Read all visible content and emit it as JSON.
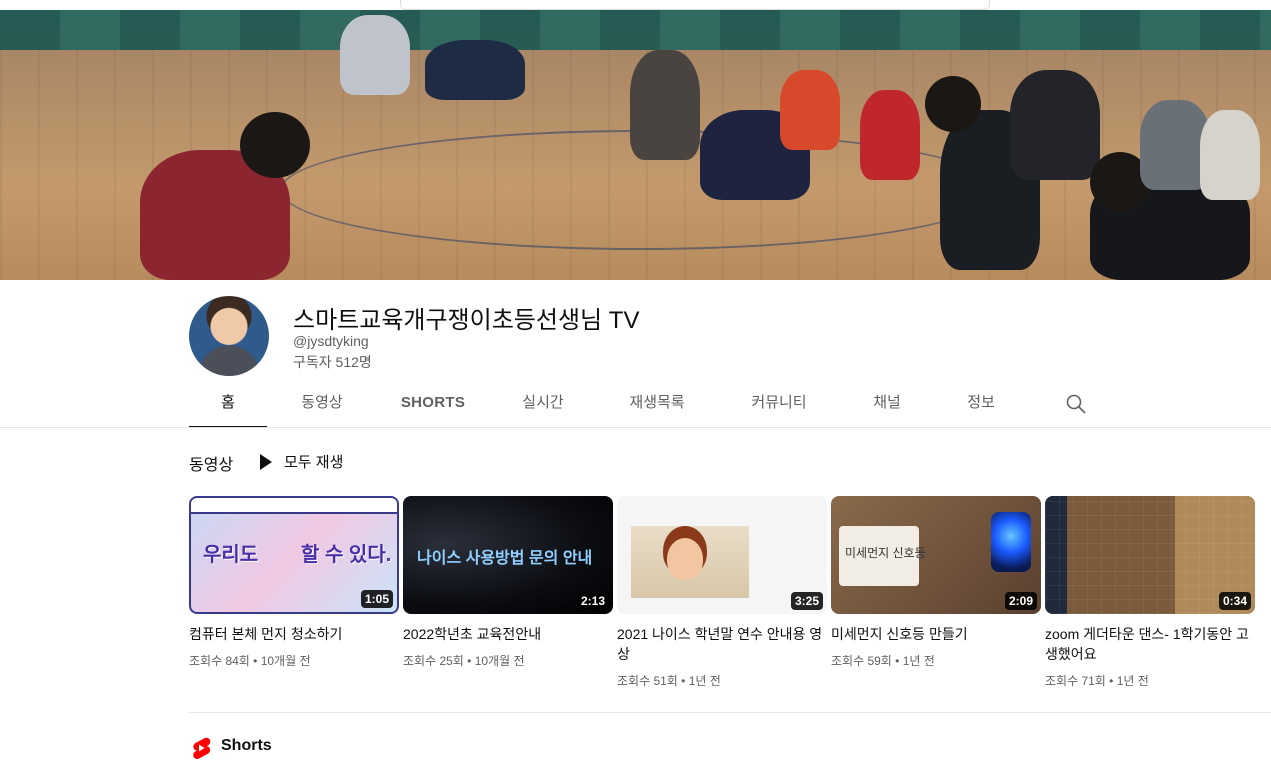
{
  "channel": {
    "name": "스마트교육개구쟁이초등선생님 TV",
    "handle": "@jysdtyking",
    "subscribers": "구독자 512명"
  },
  "tabs": [
    {
      "label": "홈"
    },
    {
      "label": "동영상"
    },
    {
      "label": "SHORTS"
    },
    {
      "label": "실시간"
    },
    {
      "label": "재생목록"
    },
    {
      "label": "커뮤니티"
    },
    {
      "label": "채널"
    },
    {
      "label": "정보"
    }
  ],
  "videos_section": {
    "title": "동영상",
    "play_all": "모두 재생"
  },
  "videos": [
    {
      "title": "컴퓨터 본체 먼지 청소하기",
      "meta": "조회수 84회 • 10개월 전",
      "duration": "1:05",
      "thumb_text_1": "우리도",
      "thumb_text_2": "할 수 있다."
    },
    {
      "title": "2022학년초 교육전안내",
      "meta": "조회수 25회 • 10개월 전",
      "duration": "2:13",
      "thumb_text": "나이스 사용방법 문의 안내"
    },
    {
      "title": "2021 나이스 학년말 연수 안내용 영상",
      "meta": "조회수 51회 • 1년 전",
      "duration": "3:25"
    },
    {
      "title": "미세먼지 신호등 만들기",
      "meta": "조회수 59회 • 1년 전",
      "duration": "2:09",
      "thumb_text": "미세먼지 신호등"
    },
    {
      "title": "zoom 게더타운 댄스- 1학기동안 고생했어요",
      "meta": "조회수 71회 • 1년 전",
      "duration": "0:34"
    }
  ],
  "shorts_section": {
    "title": "Shorts"
  }
}
